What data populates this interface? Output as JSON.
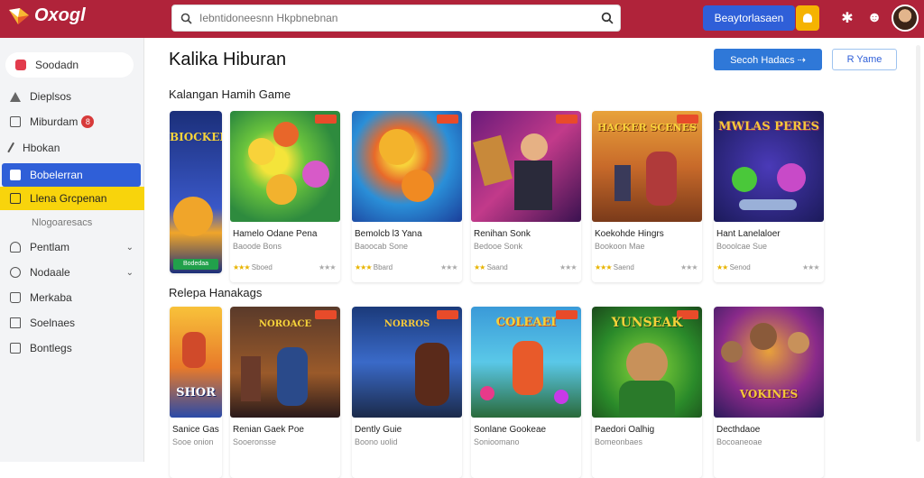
{
  "header": {
    "logo_text": "Oxogl",
    "search_placeholder": "Iebntidoneesnn Hkpbnebnan",
    "primary_button": "Beaytorlasaen",
    "brand_color": "#b0233a"
  },
  "sidebar": {
    "items": [
      {
        "label": "Soodadn",
        "icon": "home-icon"
      },
      {
        "label": "Dieplsos",
        "icon": "triangle-icon"
      },
      {
        "label": "Miburdam",
        "icon": "box-icon",
        "badge": "8"
      },
      {
        "label": "Hbokan",
        "icon": "pen-icon"
      },
      {
        "label": "Bobelerran",
        "icon": "lock-icon"
      },
      {
        "label": "Llena Grcpenan",
        "icon": "folder-icon"
      },
      {
        "label": "Nlogoaresacs"
      },
      {
        "label": "Pentlam",
        "icon": "user-icon"
      },
      {
        "label": "Nodaale",
        "icon": "settings-icon"
      },
      {
        "label": "Merkaba",
        "icon": "bag-icon"
      },
      {
        "label": "Soelnaes",
        "icon": "doc-icon"
      },
      {
        "label": "Bontlegs",
        "icon": "lock-icon"
      }
    ]
  },
  "main": {
    "title": "Kalika Hiburan",
    "primary_button": "Secoh Hadacs ⇢",
    "outline_button": "R Yame",
    "section1_title": "Kalangan Hamih Game",
    "section2_title": "Relepa Hanakags",
    "row1": [
      {
        "name": "",
        "meta": "",
        "rating": "Bodedaa",
        "art": "BIOCKER"
      },
      {
        "name": "Hamelo Odane Pena",
        "meta": "Baoode Bons",
        "stars": "★★★",
        "rating": "Sboed",
        "grey": "★★★"
      },
      {
        "name": "Bemolcb l3 Yana",
        "meta": "Baoocab Sone",
        "stars": "★★★",
        "rating": "Bbard",
        "grey": "★★★"
      },
      {
        "name": "Renihan Sonk",
        "meta": "Bedooe Sonk",
        "stars": "★★",
        "rating": "Saand",
        "grey": "★★★"
      },
      {
        "name": "Koekohde Hingrs",
        "meta": "Bookoon Mae",
        "stars": "★★★",
        "rating": "Saend",
        "grey": "★★★"
      },
      {
        "name": "Hant Lanelaloer",
        "meta": "Booolcae Sue",
        "stars": "★★",
        "rating": "Senod",
        "grey": "★★★"
      }
    ],
    "row2": [
      {
        "name": "Sanice Gas",
        "meta": "Sooe onion",
        "art": "SHOR"
      },
      {
        "name": "Renian Gaek Poe",
        "meta": "Sooeronsse",
        "art": "NOROACE"
      },
      {
        "name": "Dently Guie",
        "meta": "Boono uolid",
        "art": "NORROS"
      },
      {
        "name": "Sonlane Gookeae",
        "meta": "Sonioomano",
        "art": "COLEAEI"
      },
      {
        "name": "Paedori Oalhig",
        "meta": "Bomeonbaes",
        "art": "YUNSEAK"
      },
      {
        "name": "Decthdaoe",
        "meta": "Bocoaneoae",
        "art": "VOKINES"
      }
    ],
    "row1_art": [
      "",
      "",
      "",
      "",
      "HACKER SCENES",
      "MWLAS PERES"
    ]
  }
}
